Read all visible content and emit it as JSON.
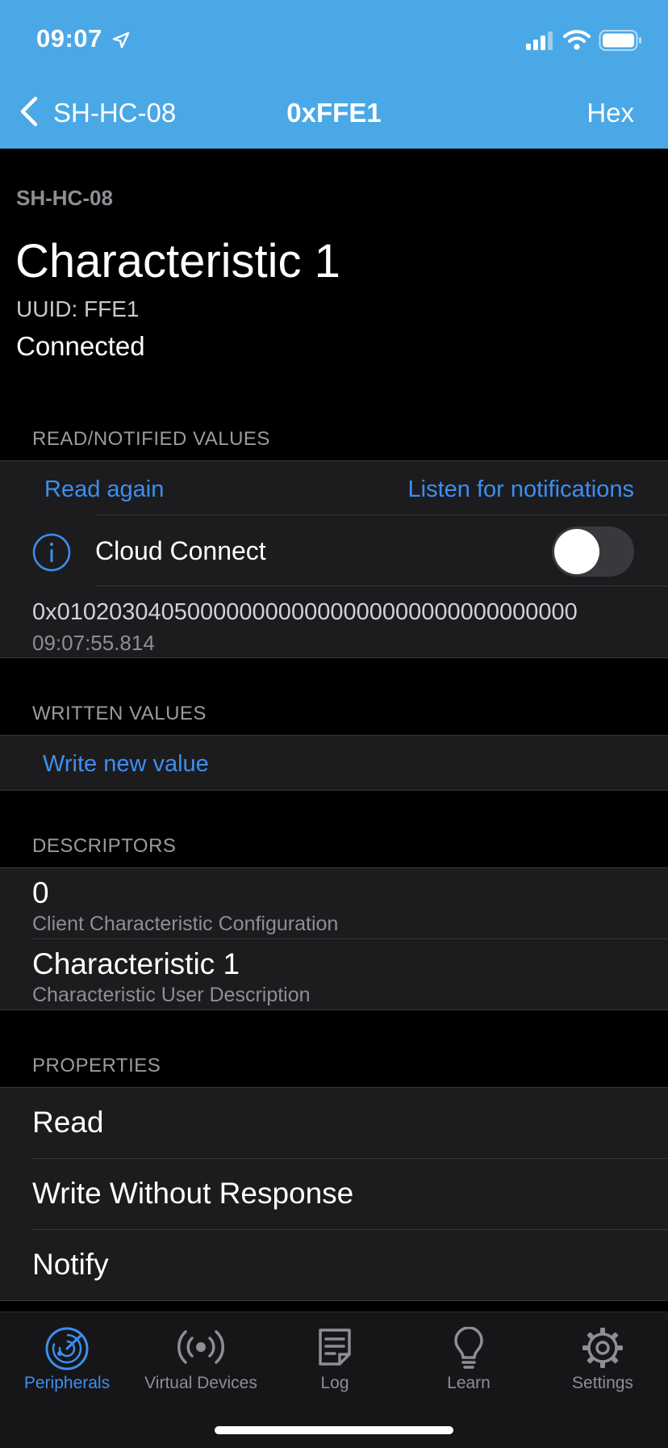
{
  "status_bar": {
    "time": "09:07"
  },
  "nav": {
    "back_label": "SH-HC-08",
    "title": "0xFFE1",
    "right_button": "Hex"
  },
  "characteristic": {
    "device": "SH-HC-08",
    "name": "Characteristic 1",
    "uuid": "UUID: FFE1",
    "status": "Connected"
  },
  "read_section": {
    "header": "READ/NOTIFIED VALUES",
    "read_again": "Read again",
    "listen": "Listen for notifications",
    "cloud_label": "Cloud Connect",
    "cloud_enabled": false,
    "value": "0x0102030405000000000000000000000000000000",
    "timestamp": "09:07:55.814"
  },
  "written_section": {
    "header": "WRITTEN VALUES",
    "write_new": "Write new value"
  },
  "descriptors": {
    "header": "DESCRIPTORS",
    "items": [
      {
        "value": "0",
        "name": "Client Characteristic Configuration"
      },
      {
        "value": "Characteristic 1",
        "name": "Characteristic User Description"
      }
    ]
  },
  "properties": {
    "header": "PROPERTIES",
    "items": [
      "Read",
      "Write Without Response",
      "Notify"
    ]
  },
  "tabs": [
    {
      "label": "Peripherals",
      "icon": "radar-icon",
      "active": true
    },
    {
      "label": "Virtual Devices",
      "icon": "broadcast-icon",
      "active": false
    },
    {
      "label": "Log",
      "icon": "document-icon",
      "active": false
    },
    {
      "label": "Learn",
      "icon": "lightbulb-icon",
      "active": false
    },
    {
      "label": "Settings",
      "icon": "gear-icon",
      "active": false
    }
  ],
  "colors": {
    "header_bg": "#4aa8e6",
    "accent": "#3d8ef0",
    "cell_bg": "#1c1c1e"
  }
}
